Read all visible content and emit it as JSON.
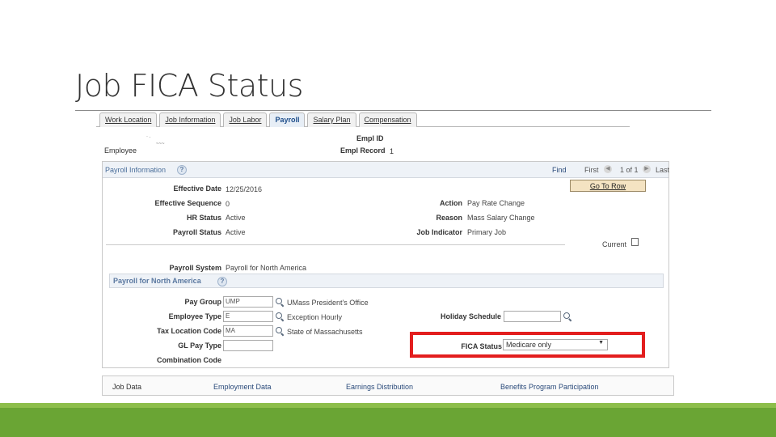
{
  "slide": {
    "title": "Job FICA Status"
  },
  "tabs": [
    {
      "label": "Work Location"
    },
    {
      "label": "Job Information"
    },
    {
      "label": "Job Labor"
    },
    {
      "label": "Payroll"
    },
    {
      "label": "Salary Plan"
    },
    {
      "label": "Compensation"
    }
  ],
  "header": {
    "employee_label": "Employee",
    "emplid_label": "Empl ID",
    "empl_record_label": "Empl Record",
    "empl_record_value": "1"
  },
  "payroll_info": {
    "title": "Payroll Information",
    "find": "Find",
    "first": "First",
    "pager": "1 of 1",
    "last": "Last",
    "goto_row": "Go To Row",
    "effective_date_label": "Effective Date",
    "effective_date": "12/25/2016",
    "effective_sequence_label": "Effective Sequence",
    "effective_sequence": "0",
    "hr_status_label": "HR Status",
    "hr_status": "Active",
    "payroll_status_label": "Payroll Status",
    "payroll_status": "Active",
    "action_label": "Action",
    "action": "Pay Rate Change",
    "reason_label": "Reason",
    "reason": "Mass Salary Change",
    "job_indicator_label": "Job Indicator",
    "job_indicator": "Primary Job",
    "current_label": "Current",
    "payroll_system_label": "Payroll System",
    "payroll_system": "Payroll for North America"
  },
  "pna": {
    "title": "Payroll for North America",
    "pay_group_label": "Pay Group",
    "pay_group": "UMP",
    "pay_group_desc": "UMass President's Office",
    "employee_type_label": "Employee Type",
    "employee_type": "E",
    "employee_type_desc": "Exception Hourly",
    "tax_location_label": "Tax Location Code",
    "tax_location": "MA",
    "tax_location_desc": "State of Massachusetts",
    "gl_pay_type_label": "GL Pay Type",
    "gl_pay_type": "",
    "combination_code_label": "Combination Code",
    "holiday_schedule_label": "Holiday Schedule",
    "holiday_schedule": "",
    "fica_status_label": "FICA Status",
    "fica_status": "Medicare only"
  },
  "footer": {
    "job_data": "Job Data",
    "employment_data": "Employment Data",
    "earnings_distribution": "Earnings Distribution",
    "benefits_program": "Benefits Program Participation"
  },
  "colors": {
    "highlight": "#e31e1e",
    "band": "#6aa534",
    "band_light": "#8dbe4b"
  }
}
